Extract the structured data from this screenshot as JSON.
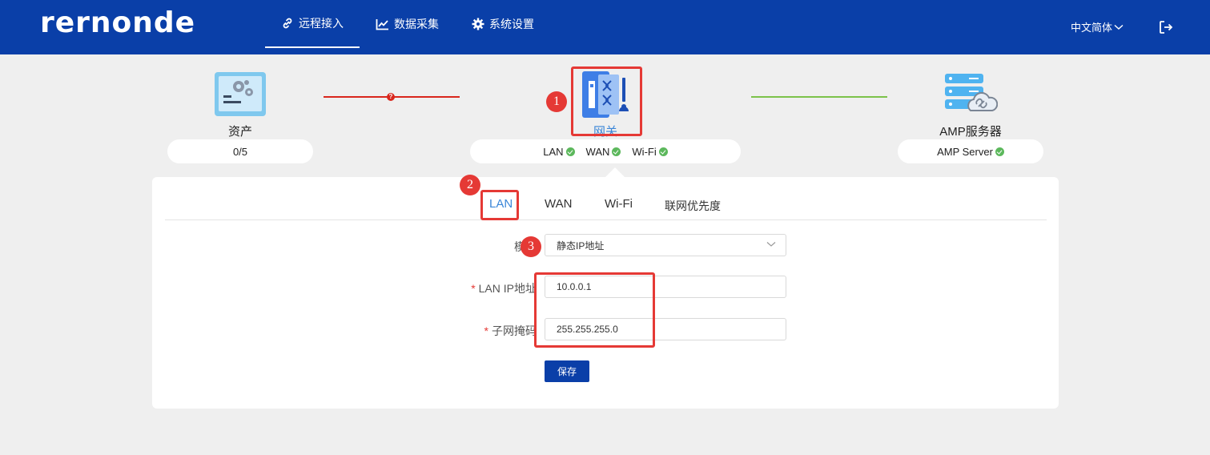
{
  "header": {
    "logo": "rernonde",
    "nav": [
      {
        "label": "远程接入",
        "icon": "link-icon"
      },
      {
        "label": "数据采集",
        "icon": "chart-icon"
      },
      {
        "label": "系统设置",
        "icon": "gear-icon"
      }
    ],
    "language": "中文简体",
    "logout_icon": "logout-icon"
  },
  "topology": {
    "asset": {
      "title": "资产",
      "count": "0/5"
    },
    "gateway": {
      "title": "网关",
      "status": [
        {
          "label": "LAN"
        },
        {
          "label": "WAN"
        },
        {
          "label": "Wi-Fi"
        }
      ]
    },
    "server": {
      "title": "AMP服务器",
      "status_label": "AMP Server"
    },
    "left_link_warning": "?"
  },
  "annotations": [
    "1",
    "2",
    "3"
  ],
  "tabs": [
    {
      "label": "LAN",
      "active": true
    },
    {
      "label": "WAN",
      "active": false
    },
    {
      "label": "Wi-Fi",
      "active": false
    },
    {
      "label": "联网优先度",
      "active": false
    }
  ],
  "form": {
    "mode_label": "模式",
    "mode_value": "静态IP地址",
    "lan_ip_label": "LAN IP地址",
    "lan_ip_value": "10.0.0.1",
    "subnet_label": "子网掩码",
    "subnet_value": "255.255.255.0",
    "required_mark": "*",
    "save_label": "保存"
  },
  "colors": {
    "brand": "#0a3fa8",
    "active_tab": "#3a86d8",
    "ok": "#5cb85c",
    "error_link": "#d9261c",
    "ok_link": "#7cc24a",
    "annotation": "#e53935"
  }
}
